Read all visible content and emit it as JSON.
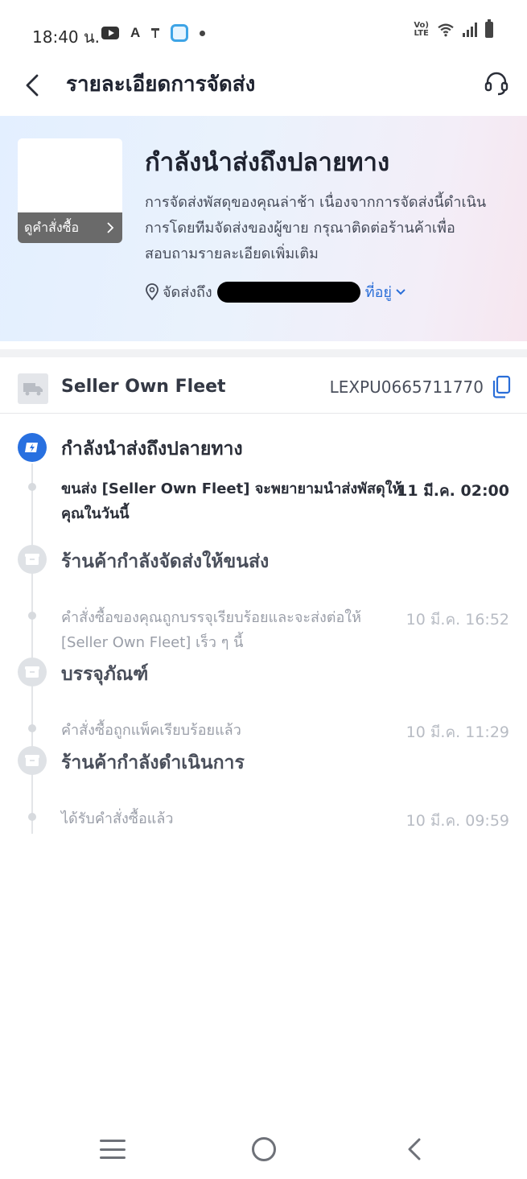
{
  "status_bar": {
    "time": "18:40 น.",
    "letter_a": "A",
    "volte": "VoLTE",
    "icons": [
      "youtube-icon",
      "a-letter-icon",
      "pin-icon",
      "app-face-icon",
      "dot-icon",
      "volte-icon",
      "wifi-icon",
      "signal-icon",
      "battery-icon"
    ]
  },
  "header": {
    "title": "รายละเอียดการจัดส่ง",
    "back_icon": "chevron-left-icon",
    "support_icon": "headset-icon"
  },
  "banner": {
    "status_title": "กำลังนำส่งถึงปลายทาง",
    "description": "การจัดส่งพัสดุของคุณล่าช้า เนื่องจากการจัดส่งนี้ดำเนินการโดยทีมจัดส่งของผู้ขาย กรุณาติดต่อร้านค้าเพื่อสอบถามรายละเอียดเพิ่มเติม",
    "view_order_label": "ดูคำสั่งซื้อ",
    "ship_to_label": "จัดส่งถึง",
    "address_link": "ที่อยู่",
    "accent": "#2a6ed8"
  },
  "carrier": {
    "name": "Seller Own Fleet",
    "tracking_number": "LEXPU0665711770",
    "icons": [
      "truck-icon",
      "copy-icon"
    ]
  },
  "timeline": {
    "milestones": [
      {
        "title": "กำลังนำส่งถึงปลายทาง",
        "state": "active",
        "events": [
          {
            "text": "ขนส่ง [Seller Own Fleet] จะพยายามนำส่งพัสดุให้คุณในวันนี้",
            "time": "11 มี.ค. 02:00"
          }
        ]
      },
      {
        "title": "ร้านค้ากำลังจัดส่งให้ขนส่ง",
        "state": "past",
        "events": [
          {
            "text": "คำสั่งซื้อของคุณถูกบรรจุเรียบร้อยและจะส่งต่อให้ [Seller Own Fleet] เร็ว ๆ นี้",
            "time": "10 มี.ค. 16:52"
          }
        ]
      },
      {
        "title": "บรรจุภัณฑ์",
        "state": "past",
        "events": [
          {
            "text": "คำสั่งซื้อถูกแพ็คเรียบร้อยแล้ว",
            "time": "10 มี.ค. 11:29"
          }
        ]
      },
      {
        "title": "ร้านค้ากำลังดำเนินการ",
        "state": "past",
        "events": [
          {
            "text": "ได้รับคำสั่งซื้อแล้ว",
            "time": "10 มี.ค. 09:59"
          }
        ]
      }
    ],
    "colors": {
      "active": "#2870e0",
      "past": "#dfe2e6"
    }
  },
  "nav_bar": {
    "icons": [
      "menu-icon",
      "home-icon",
      "back-icon"
    ]
  }
}
